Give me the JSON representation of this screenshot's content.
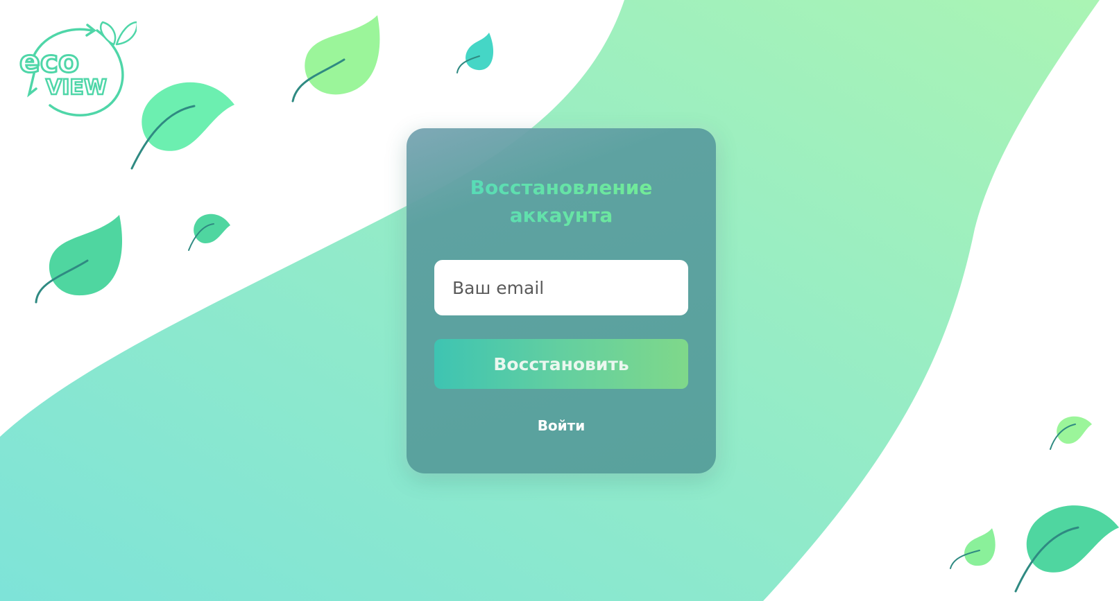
{
  "brand": {
    "logo_name": "ecoview-logo",
    "logo_text_top": "eco",
    "logo_text_bottom": "VIEW",
    "accent_color": "#4fd6a8"
  },
  "recovery": {
    "title": "Восстановление\nаккаунта",
    "email_placeholder": "Ваш email",
    "email_value": "",
    "submit_label": "Восстановить",
    "login_link_label": "Войти"
  },
  "colors": {
    "wave_start": "#7ee3d8",
    "wave_end": "#a6f2bc",
    "leaf_dark": "#4fd6a0",
    "leaf_light": "#9bf59a",
    "leaf_teal": "#45d6c6",
    "stem": "#2f8a82"
  }
}
